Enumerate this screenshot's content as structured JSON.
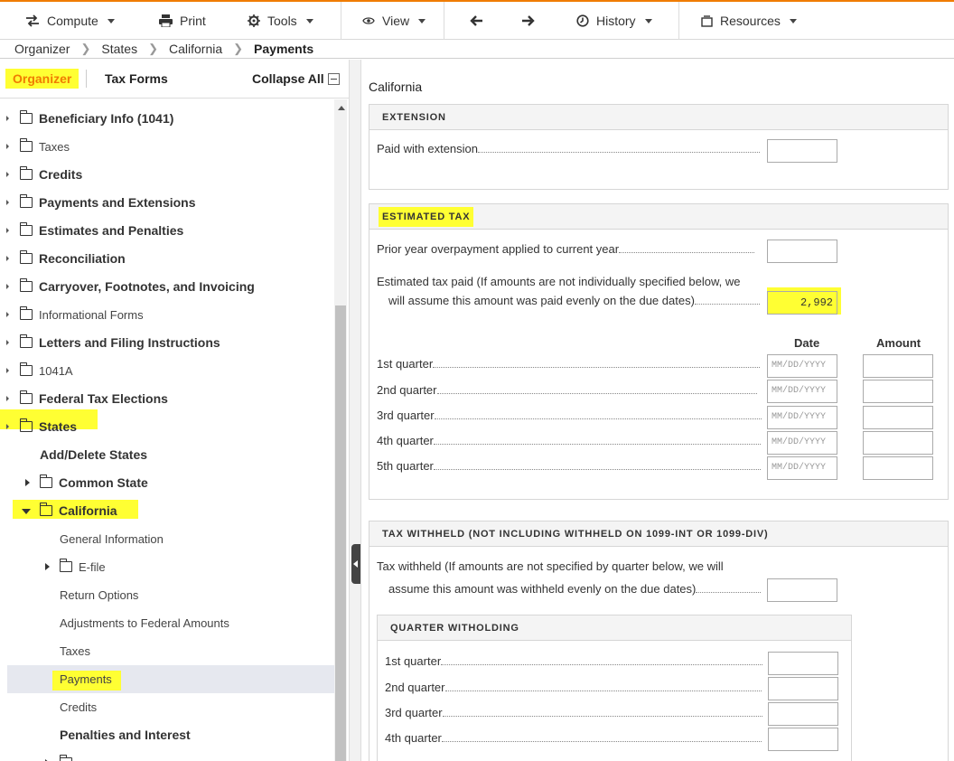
{
  "toolbar": {
    "compute": "Compute",
    "print": "Print",
    "tools": "Tools",
    "view": "View",
    "history": "History",
    "resources": "Resources"
  },
  "breadcrumb": [
    "Organizer",
    "States",
    "California",
    "Payments"
  ],
  "left_tabs": {
    "organizer": "Organizer",
    "tax_forms": "Tax Forms",
    "collapse_all": "Collapse All"
  },
  "tree": [
    {
      "label": "Beneficiary Info (1041)"
    },
    {
      "label": "Taxes"
    },
    {
      "label": "Credits"
    },
    {
      "label": "Payments and Extensions"
    },
    {
      "label": "Estimates and Penalties"
    },
    {
      "label": "Reconciliation"
    },
    {
      "label": "Carryover, Footnotes, and Invoicing"
    },
    {
      "label": "Informational Forms"
    },
    {
      "label": "Letters and Filing Instructions"
    },
    {
      "label": "1041A"
    },
    {
      "label": "Federal Tax Elections"
    },
    {
      "label": "States"
    },
    {
      "label": "Add/Delete States"
    },
    {
      "label": "Common State"
    },
    {
      "label": "California"
    },
    {
      "label": "General Information"
    },
    {
      "label": "E-file"
    },
    {
      "label": "Return Options"
    },
    {
      "label": "Adjustments to Federal Amounts"
    },
    {
      "label": "Taxes"
    },
    {
      "label": "Payments"
    },
    {
      "label": "Credits"
    },
    {
      "label": "Penalties and Interest"
    }
  ],
  "main": {
    "title": "California",
    "extension": {
      "header": "EXTENSION",
      "paid_label": "Paid with extension",
      "paid_value": ""
    },
    "estimated": {
      "header": "ESTIMATED TAX",
      "prior_label": "Prior year overpayment applied to current year",
      "prior_value": "",
      "paid_label_1": "Estimated tax paid (If amounts are not individually specified below, we",
      "paid_label_2": "will assume this amount was paid evenly on the due dates)",
      "paid_value": "2,992",
      "col_date": "Date",
      "col_amount": "Amount",
      "date_placeholder": "MM/DD/YYYY",
      "quarters": [
        "1st quarter",
        "2nd quarter",
        "3rd quarter",
        "4th quarter",
        "5th quarter"
      ]
    },
    "withheld": {
      "header": "TAX WITHHELD (NOT INCLUDING WITHHELD ON 1099-INT OR 1099-DIV)",
      "label_1": "Tax withheld (If amounts are not specified by quarter below, we will",
      "label_2": "assume this amount was withheld evenly on the due dates)",
      "value": "",
      "sub_header": "QUARTER WITHOLDING",
      "quarters": [
        "1st quarter",
        "2nd quarter",
        "3rd quarter",
        "4th quarter"
      ]
    }
  },
  "colors": {
    "accent": "#f07c00",
    "highlight": "#ffff33",
    "selected_row": "#e6e8ef"
  }
}
